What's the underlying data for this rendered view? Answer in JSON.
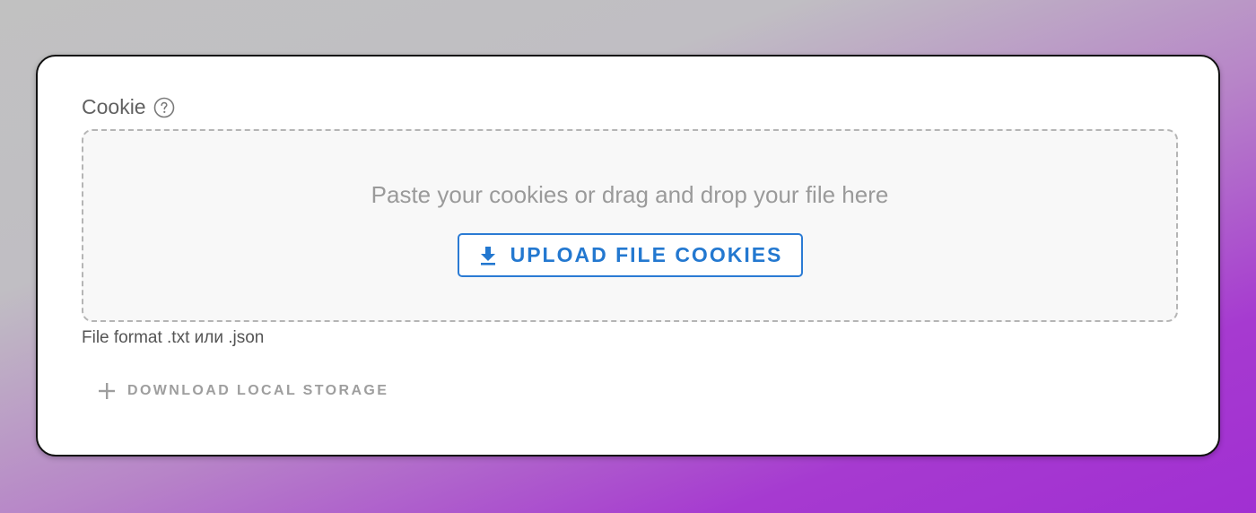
{
  "cookie_field": {
    "label": "Cookie",
    "help_icon": "question-circle-icon",
    "dropzone": {
      "hint": "Paste your cookies or drag and drop your file here",
      "upload_button": {
        "label": "UPLOAD FILE COOKIES",
        "icon": "download-icon"
      }
    },
    "helper_text": "File format .txt или .json"
  },
  "download_local_storage": {
    "label": "DOWNLOAD LOCAL STORAGE",
    "icon": "plus-icon"
  },
  "colors": {
    "accent": "#2378d0",
    "label_text": "#616161",
    "hint_text": "#9a9a9a",
    "muted_button": "#9e9e9e",
    "dropzone_bg": "#f8f8f8",
    "dropzone_border": "#b5b5b5"
  }
}
